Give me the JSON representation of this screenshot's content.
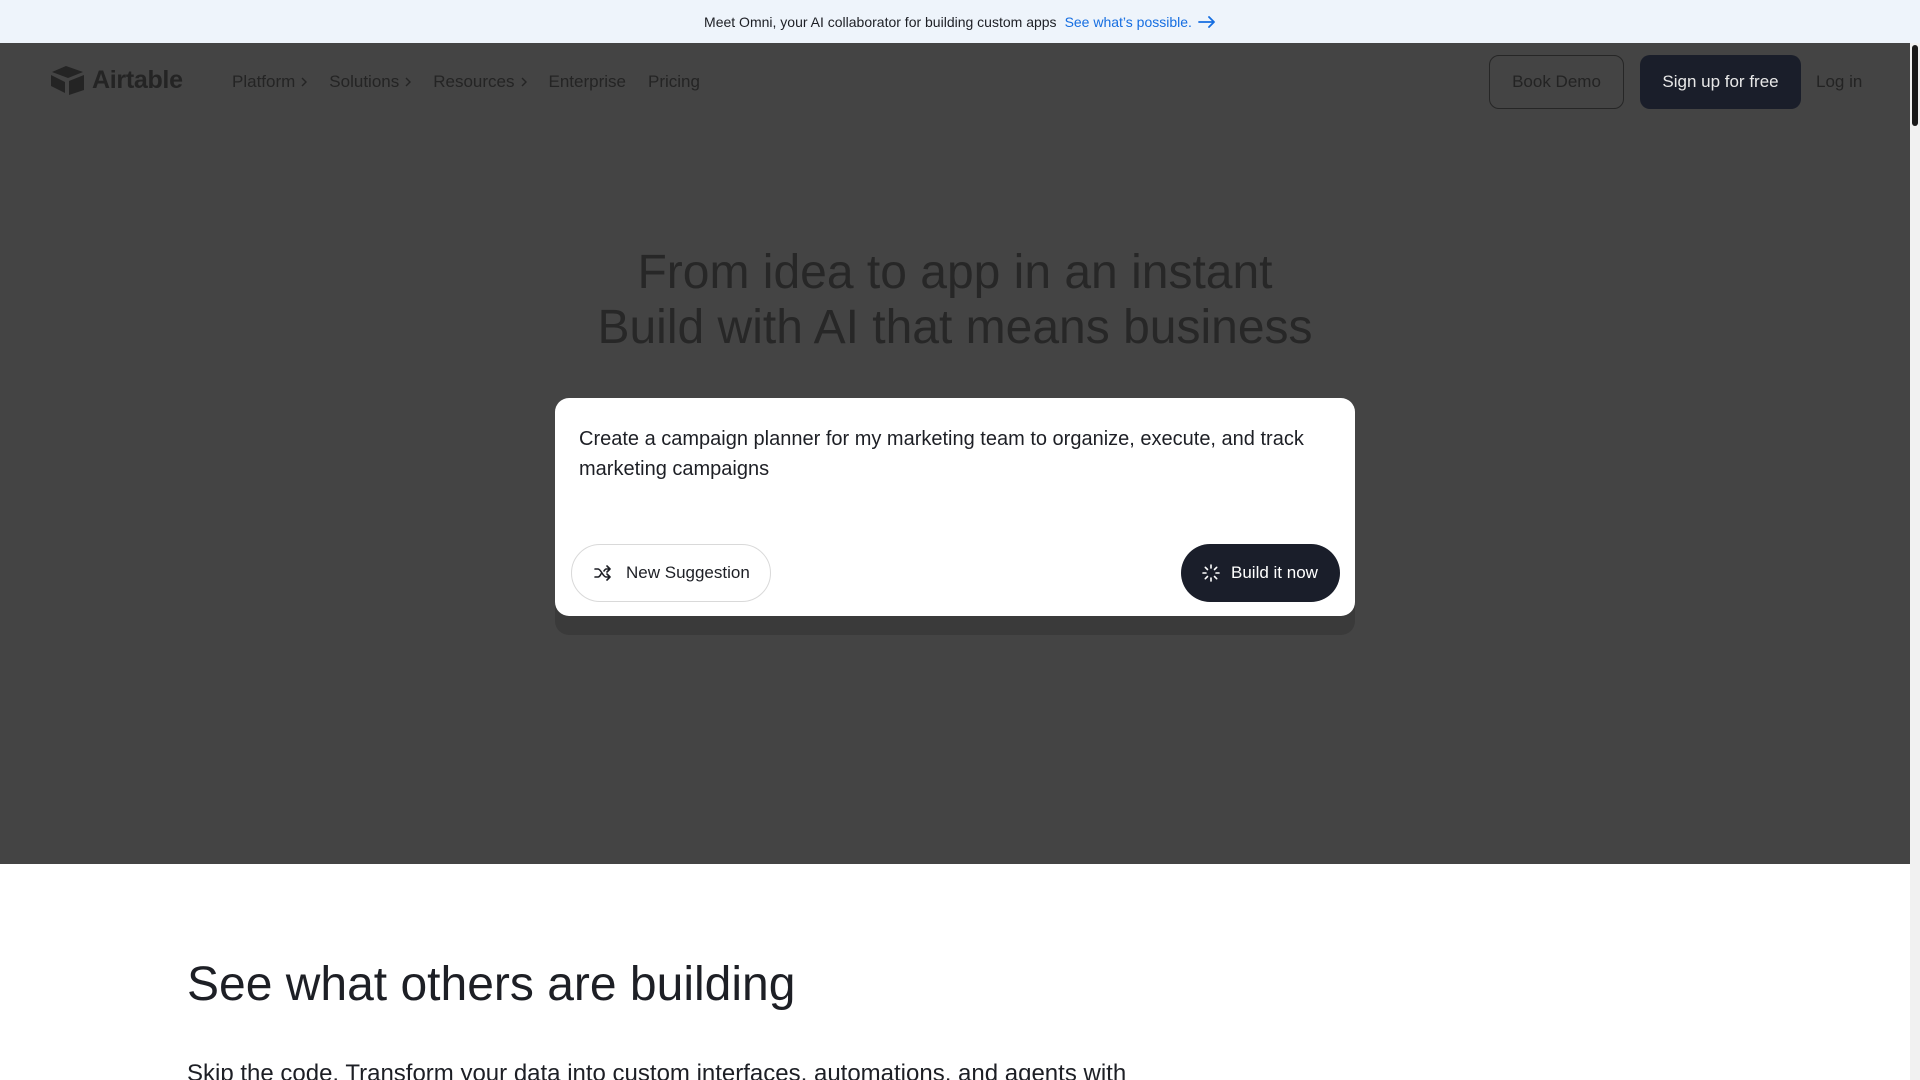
{
  "banner": {
    "message": "Meet Omni, your AI collaborator for building custom apps",
    "link": "See what’s possible."
  },
  "nav": {
    "logo_text": "Airtable",
    "items": [
      {
        "label": "Platform",
        "has_chevron": true
      },
      {
        "label": "Solutions",
        "has_chevron": true
      },
      {
        "label": "Resources",
        "has_chevron": true
      },
      {
        "label": "Enterprise",
        "has_chevron": false
      },
      {
        "label": "Pricing",
        "has_chevron": false
      }
    ],
    "book_demo": "Book Demo",
    "sign_up": "Sign up for free",
    "log_in": "Log in"
  },
  "hero": {
    "headline_line1": "From idea to app in an instant",
    "headline_line2": "Build with AI that means business",
    "prompt": "Create a campaign planner for my marketing team to organize, execute, and track marketing campaigns",
    "new_suggestion": "New Suggestion",
    "build_now": "Build it now"
  },
  "section": {
    "title": "See what others are building",
    "subtitle": "Skip the code. Transform your data into custom interfaces, automations, and agents with"
  },
  "colors": {
    "banner_bg": "#eef4fb",
    "link": "#166ee1",
    "overlay": "#444444",
    "button_dark": "#1a1e2a"
  }
}
